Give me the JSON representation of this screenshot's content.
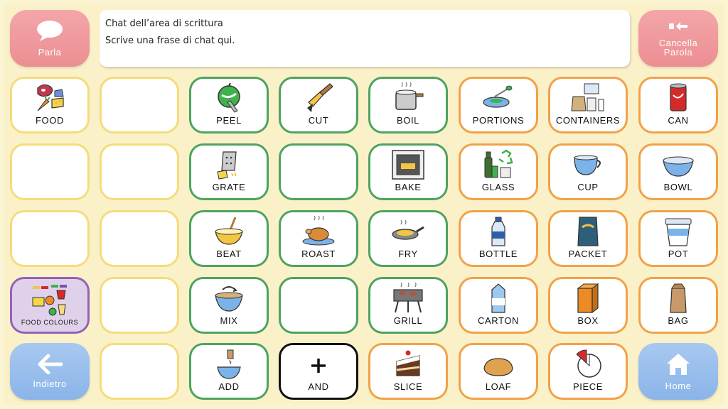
{
  "top": {
    "speak_label": "Parla",
    "clear_label_1": "Cancella",
    "clear_label_2": "Parola",
    "chat_line1": "Chat dell’area di scrittura",
    "chat_line2": "Scrive una frase di chat qui."
  },
  "bottom": {
    "back_label": "Indietro",
    "home_label": "Home"
  },
  "cells": {
    "food": "FOOD",
    "peel": "PEEL",
    "cut": "CUT",
    "boil": "BOIL",
    "portions": "PORTIONS",
    "containers": "CONTAINERS",
    "can": "CAN",
    "grate": "GRATE",
    "bake": "BAKE",
    "glass": "GLASS",
    "cup": "CUP",
    "bowl": "BOWL",
    "beat": "BEAT",
    "roast": "ROAST",
    "fry": "FRY",
    "bottle": "BOTTLE",
    "packet": "PACKET",
    "pot": "POT",
    "food_colours": "FOOD COLOURS",
    "mix": "MIX",
    "grill": "GRILL",
    "carton": "CARTON",
    "box": "BOX",
    "bag": "BAG",
    "add": "ADD",
    "and": "AND",
    "slice": "SLICE",
    "loaf": "LOAF",
    "piece": "PIECE"
  },
  "colors": {
    "background": "#fbf1c9",
    "border_yellow": "#f4dc7c",
    "border_green": "#4ea35f",
    "border_orange": "#f1a248",
    "border_purple": "#9561b5",
    "pink_button": "#ec8e92",
    "blue_button": "#8ab4e8"
  }
}
